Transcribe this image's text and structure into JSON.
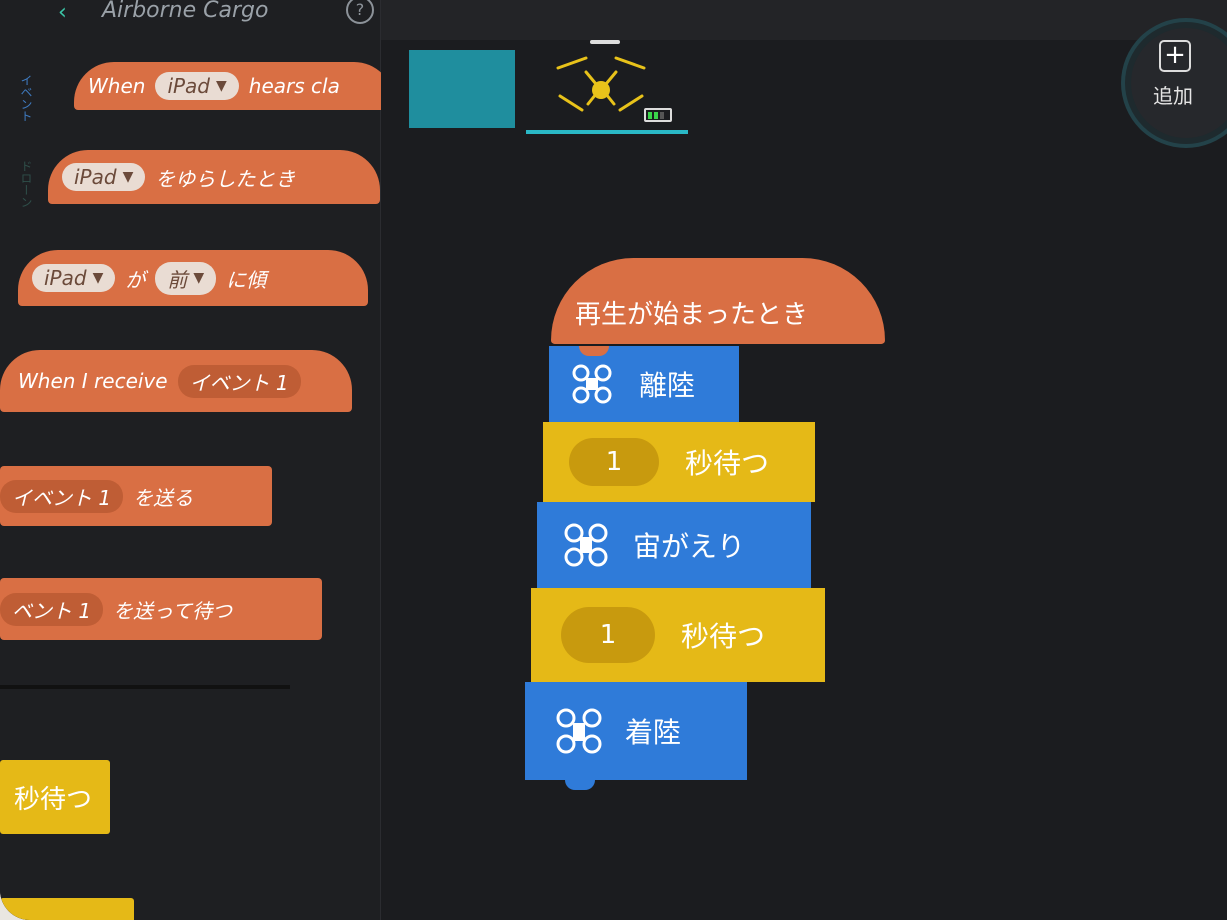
{
  "header": {
    "back_icon": "chevron-left-icon",
    "title": "Airborne Cargo",
    "help": "?"
  },
  "palette": {
    "category_events": "イベント",
    "category_drone": "ドローン",
    "blocks": [
      {
        "prefix": "When",
        "pill": "iPad",
        "suffix": "hears cla"
      },
      {
        "pill": "iPad",
        "suffix": "をゆらしたとき"
      },
      {
        "pill": "iPad",
        "mid": "が",
        "pill2": "前",
        "suffix": "に傾"
      },
      {
        "prefix": "When I receive",
        "pill": "イベント 1"
      },
      {
        "pill": "イベント 1",
        "suffix": "を送る"
      },
      {
        "pill": "ベント 1",
        "suffix": "を送って待つ"
      }
    ],
    "control_block": "秒待つ"
  },
  "sprites": {
    "add_label": "追加",
    "add_icon": "+",
    "battery_level": 0.67
  },
  "script": {
    "hat": "再生が始まったとき",
    "blocks": [
      {
        "type": "drone",
        "icon": "drone-icon",
        "label": "離陸"
      },
      {
        "type": "wait",
        "value": "1",
        "label": "秒待つ"
      },
      {
        "type": "drone",
        "icon": "drone-flip-icon",
        "label": "宙がえり"
      },
      {
        "type": "wait",
        "value": "1",
        "label": "秒待つ"
      },
      {
        "type": "drone",
        "icon": "drone-land-icon",
        "label": "着陸"
      }
    ]
  },
  "colors": {
    "events": "#d96f44",
    "drone": "#2f7bd9",
    "control": "#e5b917",
    "accent": "#2ab8c6"
  }
}
